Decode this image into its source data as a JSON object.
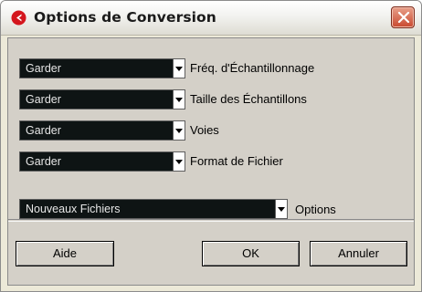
{
  "window": {
    "title": "Options de Conversion"
  },
  "rows": [
    {
      "value": "Garder",
      "label": "Fréq. d'Échantillonnage"
    },
    {
      "value": "Garder",
      "label": "Taille des Échantillons"
    },
    {
      "value": "Garder",
      "label": "Voies"
    },
    {
      "value": "Garder",
      "label": "Format de Fichier"
    }
  ],
  "options": {
    "value": "Nouveaux Fichiers",
    "label": "Options"
  },
  "buttons": {
    "help": "Aide",
    "ok": "OK",
    "cancel": "Annuler"
  },
  "colors": {
    "select_bg": "#0e1414",
    "dialog_bg": "#d4d0c8",
    "accent_red": "#d4161d"
  }
}
